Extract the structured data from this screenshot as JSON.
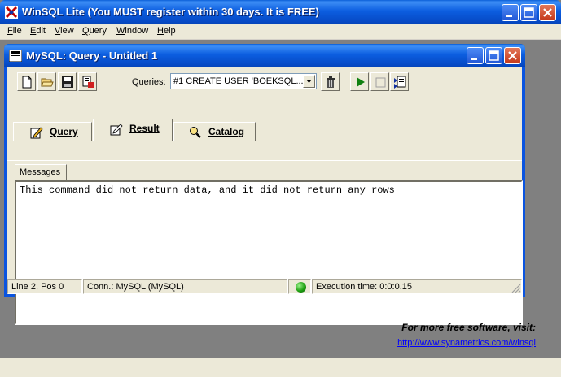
{
  "app": {
    "title": "WinSQL Lite (You MUST register within 30 days. It is FREE)"
  },
  "menu": {
    "items": [
      {
        "label": "File",
        "key": "F"
      },
      {
        "label": "Edit",
        "key": "E"
      },
      {
        "label": "View",
        "key": "V"
      },
      {
        "label": "Query",
        "key": "Q"
      },
      {
        "label": "Window",
        "key": "W"
      },
      {
        "label": "Help",
        "key": "H"
      }
    ]
  },
  "child": {
    "title": "MySQL: Query - Untitled 1"
  },
  "toolbar": {
    "queries_label": "Queries:",
    "queries_value": "#1 CREATE USER 'BOEKSQL..."
  },
  "tabs": [
    {
      "label": "Query"
    },
    {
      "label": "Result"
    },
    {
      "label": "Catalog"
    }
  ],
  "messages": {
    "tab_label": "Messages",
    "text": "This command did not return data, and it did not return any rows"
  },
  "status": {
    "position": "Line 2, Pos 0",
    "connection": "Conn.: MySQL (MySQL)",
    "execution": "Execution time: 0:0:0.15"
  },
  "promo": {
    "heading": "For more free software, visit:",
    "link": "http://www.synametrics.com/winsql"
  },
  "colors": {
    "titlebar": "#0c5ee0",
    "face": "#ece9d8",
    "mdi": "#808080",
    "link": "#0000ff",
    "status_led": "#1ea012"
  }
}
